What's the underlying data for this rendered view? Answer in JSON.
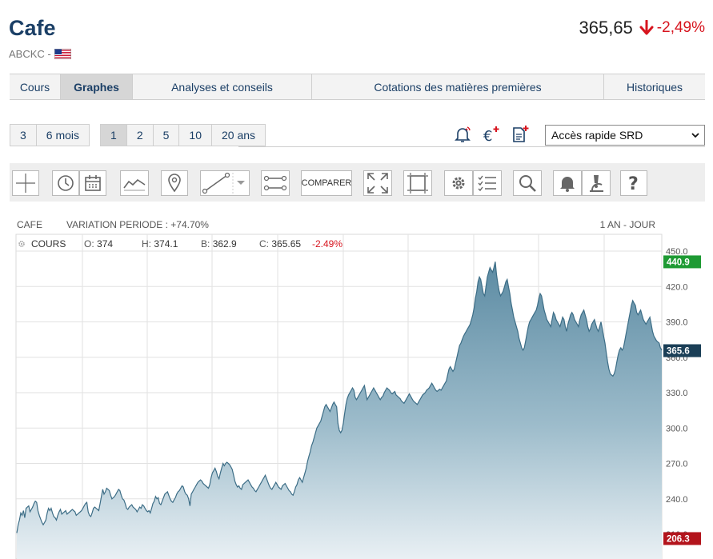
{
  "header": {
    "title": "Cafe",
    "ticker": "ABCKC -",
    "price": "365,65",
    "change": "-2,49%"
  },
  "tabs": [
    {
      "label": "Cours",
      "active": false
    },
    {
      "label": "Graphes",
      "active": true
    },
    {
      "label": "Analyses et conseils",
      "active": false
    },
    {
      "label": "Cotations des matières premières",
      "active": false
    },
    {
      "label": "Historiques",
      "active": false
    }
  ],
  "periods": {
    "group1": [
      "3",
      "6 mois"
    ],
    "group2": [
      "1",
      "2",
      "5",
      "10",
      "20 ans"
    ],
    "active": "1"
  },
  "quick_select": {
    "value": "Accès rapide SRD"
  },
  "toolbar": {
    "compare_label": "COMPARER"
  },
  "chart_header": {
    "name": "CAFE",
    "variation": "VARIATION PERIODE : +74.70%",
    "period": "1 AN - JOUR"
  },
  "ohlc": {
    "series": "COURS",
    "open_label": "O:",
    "open": "374",
    "high_label": "H:",
    "high": "374.1",
    "low_label": "B:",
    "low": "362.9",
    "close_label": "C:",
    "close": "365.65",
    "change": "-2.49%"
  },
  "colors": {
    "title": "#1b3f66",
    "negative": "#d7141e",
    "max_badge": "#1e9a33",
    "last_badge": "#1b3f57",
    "min_badge": "#b3141c",
    "line": "#3c6d86"
  },
  "chart_data": {
    "type": "area",
    "ylim": [
      210,
      450
    ],
    "yticks": [
      210,
      240,
      270,
      300,
      330,
      360,
      390,
      420,
      450
    ],
    "ytick_labels": [
      "210.0",
      "240.0",
      "270.0",
      "300.0",
      "330.0",
      "360.0",
      "390.0",
      "420.0",
      "450.0"
    ],
    "max_label": "440.9",
    "last_label": "365.6",
    "min_label": "206.3",
    "max_value": 440.9,
    "last_value": 365.6,
    "min_value": 206.3,
    "series": [
      {
        "values": [
          211,
          218,
          222,
          228,
          226,
          230,
          224,
          232,
          233,
          234,
          229,
          231,
          233,
          236,
          238,
          237,
          230,
          226,
          223,
          220,
          218,
          220,
          222,
          228,
          232,
          230,
          232,
          228,
          225,
          224,
          222,
          226,
          229,
          231,
          227,
          228,
          229,
          230,
          227,
          228,
          229,
          230,
          231,
          230,
          229,
          226,
          227,
          228,
          229,
          230,
          232,
          234,
          236,
          237,
          229,
          226,
          225,
          228,
          232,
          233,
          232,
          231,
          230,
          236,
          242,
          248,
          244,
          246,
          249,
          248,
          247,
          243,
          240,
          241,
          242,
          244,
          246,
          248,
          247,
          243,
          240,
          239,
          236,
          232,
          231,
          233,
          234,
          235,
          233,
          232,
          231,
          229,
          231,
          233,
          232,
          235,
          234,
          232,
          230,
          229,
          230,
          228,
          232,
          236,
          238,
          242,
          240,
          241,
          236,
          235,
          238,
          241,
          244,
          245,
          246,
          243,
          240,
          238,
          237,
          239,
          241,
          244,
          246,
          247,
          249,
          251,
          250,
          246,
          244,
          243,
          240,
          234,
          244,
          246,
          248,
          250,
          252,
          254,
          255,
          256,
          255,
          253,
          252,
          251,
          250,
          249,
          252,
          258,
          262,
          264,
          266,
          263,
          259,
          257,
          262,
          266,
          270,
          268,
          270,
          271,
          270,
          269,
          267,
          265,
          260,
          255,
          252,
          250,
          251,
          249,
          248,
          252,
          253,
          254,
          255,
          256,
          254,
          252,
          250,
          249,
          247,
          246,
          248,
          250,
          252,
          254,
          256,
          258,
          260,
          257,
          254,
          251,
          249,
          248,
          250,
          252,
          254,
          252,
          250,
          249,
          248,
          251,
          252,
          253,
          251,
          249,
          247,
          246,
          244,
          243,
          246,
          250,
          252,
          256,
          258,
          256,
          254,
          258,
          262,
          266,
          272,
          276,
          280,
          285,
          288,
          292,
          296,
          300,
          302,
          304,
          306,
          310,
          314,
          318,
          320,
          318,
          316,
          314,
          317,
          320,
          322,
          320,
          318,
          304,
          298,
          296,
          298,
          304,
          312,
          320,
          325,
          328,
          330,
          332,
          334,
          332,
          326,
          324,
          326,
          328,
          330,
          332,
          334,
          336,
          330,
          324,
          326,
          328,
          330,
          332,
          334,
          332,
          330,
          328,
          326,
          324,
          326,
          327,
          330,
          332,
          334,
          333,
          332,
          330,
          329,
          330,
          331,
          328,
          327,
          326,
          325,
          323,
          322,
          321,
          323,
          325,
          327,
          329,
          327,
          325,
          323,
          322,
          321,
          320,
          322,
          324,
          326,
          328,
          329,
          330,
          332,
          333,
          334,
          336,
          338,
          336,
          334,
          332,
          331,
          332,
          333,
          332,
          334,
          336,
          338,
          340,
          345,
          350,
          352,
          350,
          348,
          350,
          355,
          360,
          365,
          370,
          372,
          375,
          378,
          380,
          382,
          384,
          386,
          388,
          392,
          396,
          402,
          410,
          416,
          424,
          428,
          426,
          420,
          414,
          412,
          420,
          428,
          432,
          436,
          434,
          432,
          436,
          441,
          430,
          422,
          416,
          412,
          414,
          416,
          420,
          424,
          426,
          420,
          414,
          406,
          400,
          394,
          390,
          386,
          382,
          376,
          372,
          368,
          366,
          368,
          374,
          380,
          386,
          390,
          392,
          394,
          396,
          398,
          400,
          404,
          410,
          414,
          412,
          406,
          400,
          396,
          392,
          390,
          388,
          386,
          392,
          398,
          396,
          392,
          390,
          388,
          386,
          390,
          394,
          392,
          386,
          382,
          388,
          392,
          396,
          398,
          396,
          392,
          390,
          388,
          386,
          392,
          396,
          398,
          400,
          396,
          392,
          386,
          382,
          384,
          388,
          390,
          392,
          388,
          384,
          382,
          386,
          390,
          384,
          378,
          372,
          364,
          356,
          350,
          346,
          345,
          344,
          346,
          350,
          356,
          362,
          366,
          368,
          366,
          368,
          374,
          380,
          386,
          392,
          398,
          404,
          408,
          406,
          404,
          398,
          396,
          398,
          400,
          396,
          392,
          390,
          388,
          390,
          392,
          394,
          388,
          382,
          378,
          376,
          374,
          373,
          372,
          368,
          366
        ]
      }
    ]
  }
}
